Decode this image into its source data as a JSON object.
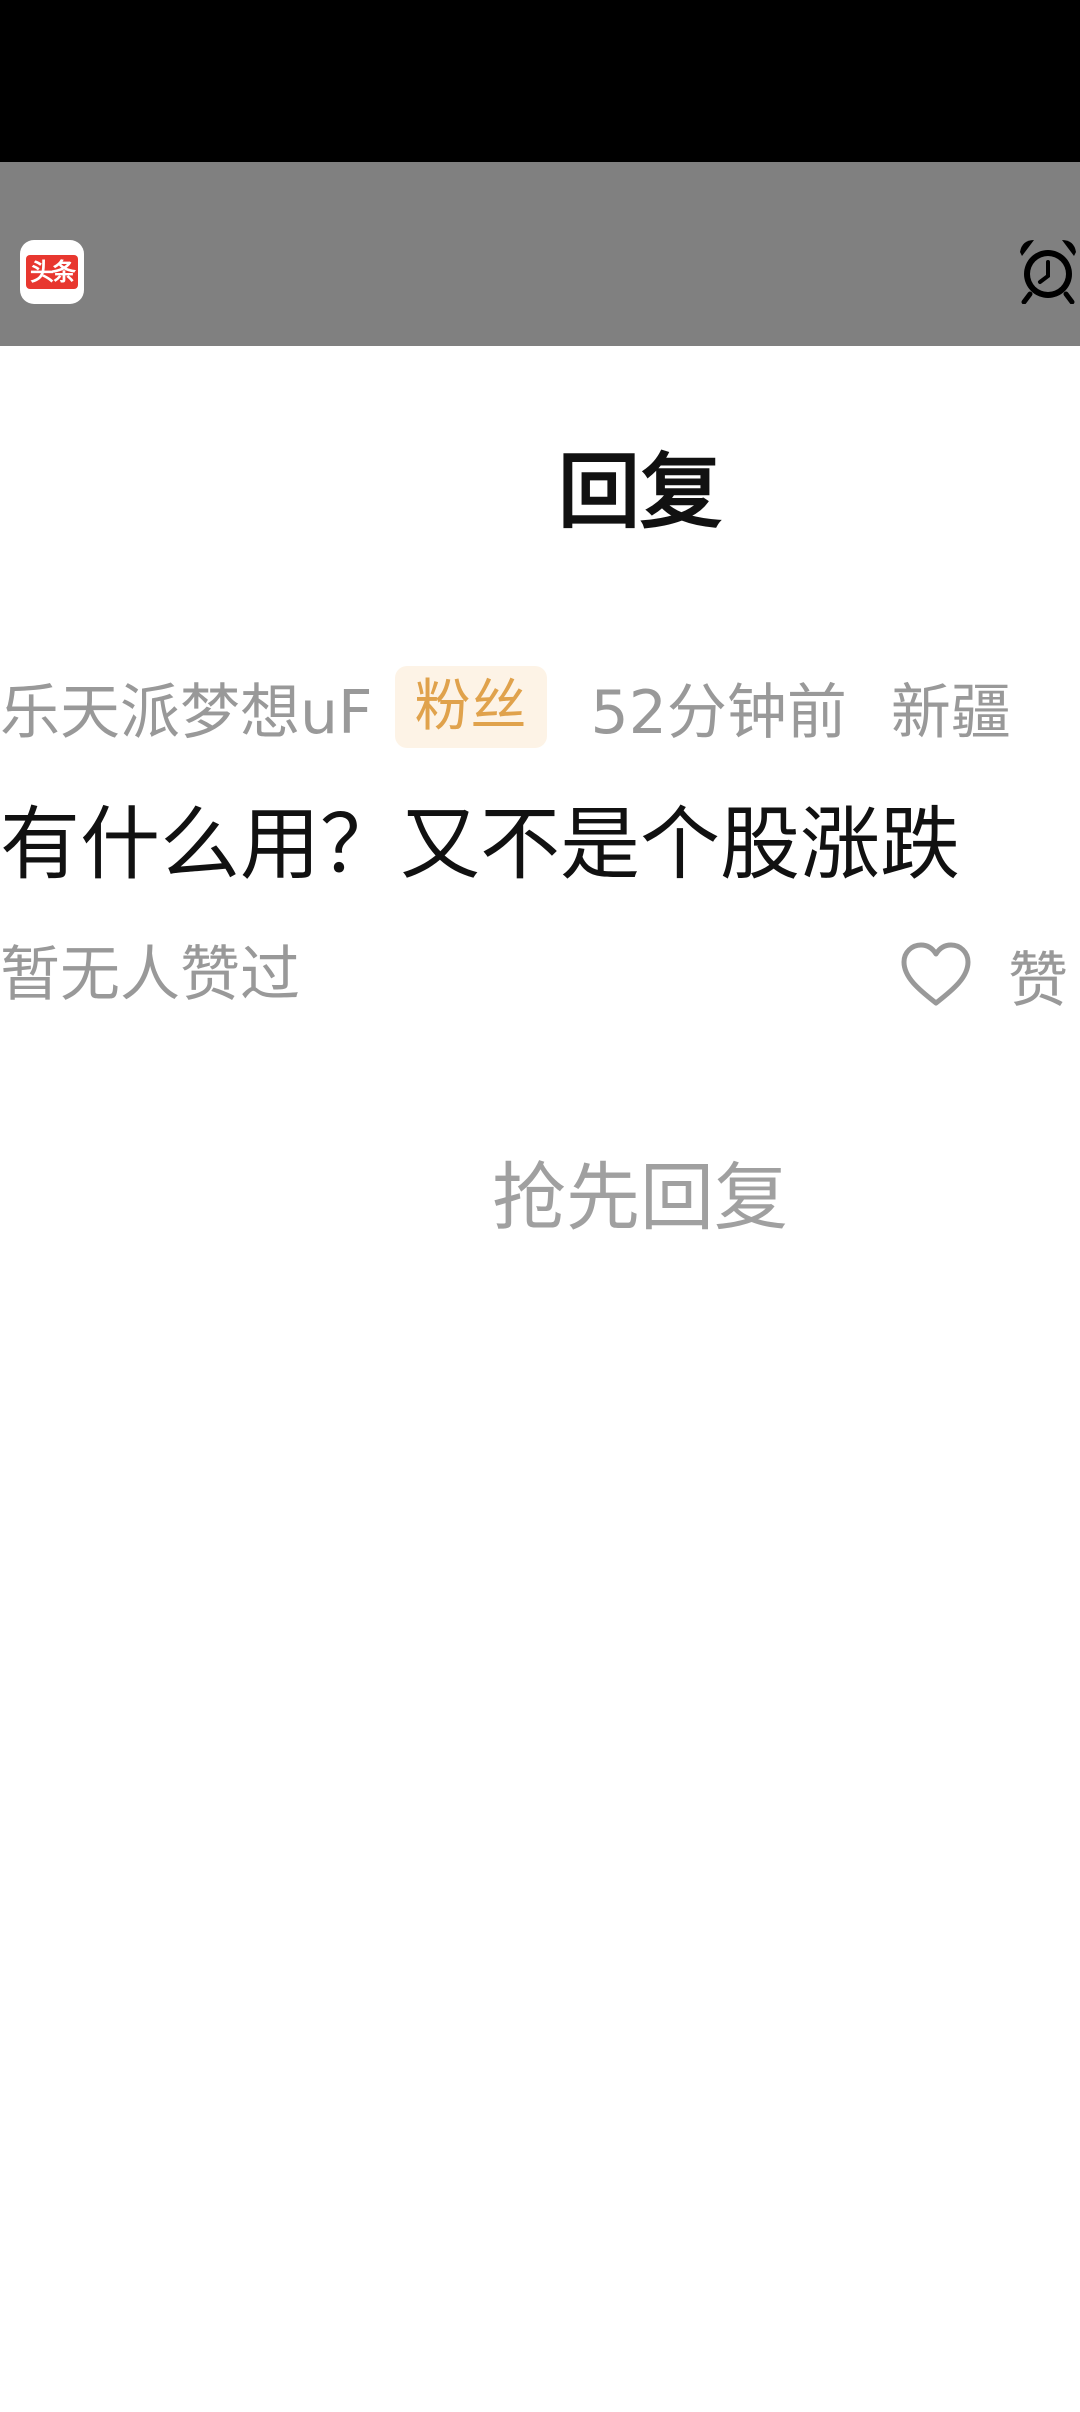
{
  "notification": {
    "app_label": "头条",
    "app_icon": "toutiao-app-icon",
    "right_icon": "alarm-clock-icon"
  },
  "page": {
    "title": "回复"
  },
  "comment": {
    "username": "乐天派梦想uF",
    "badge": "粉丝",
    "time": "52分钟前",
    "location": "新疆",
    "text": "有什么用？又不是个股涨跌",
    "likes_summary": "暂无人赞过",
    "like_label": "赞",
    "like_icon": "heart-icon"
  },
  "replies": {
    "empty_prompt": "抢先回复"
  },
  "colors": {
    "status_bar": "#000000",
    "notification_bar": "#808080",
    "badge_text": "#e0a24c",
    "badge_bg": "#fdf3e6",
    "secondary_text": "#999999"
  }
}
